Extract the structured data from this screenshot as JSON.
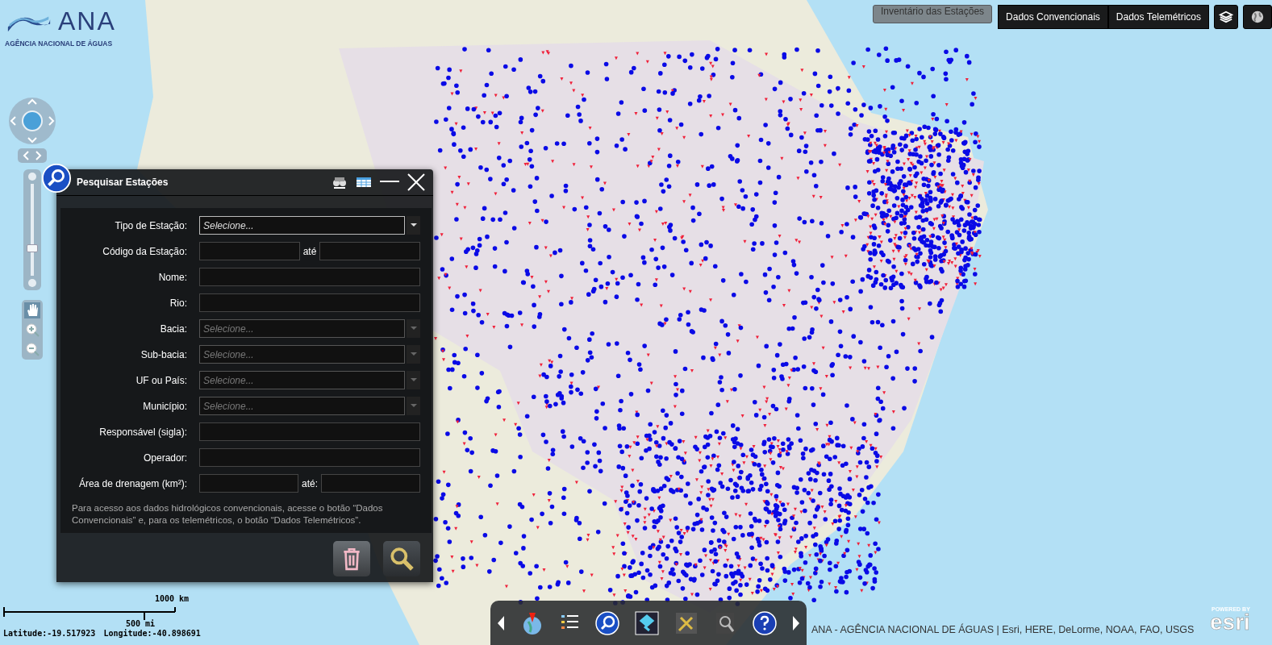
{
  "logo": {
    "name": "ANA",
    "subtitle": "AGÊNCIA NACIONAL DE ÁGUAS"
  },
  "top_buttons": [
    {
      "label": "Inventário das Estações",
      "selected": true
    },
    {
      "label": "Dados Convencionais",
      "selected": false
    },
    {
      "label": "Dados Telemétricos",
      "selected": false
    }
  ],
  "zoom_slider": {
    "level": 0.3
  },
  "search_panel": {
    "title": "Pesquisar Estações",
    "fields": [
      {
        "label": "Tipo de Estação:",
        "kind": "select",
        "placeholder": "Selecione...",
        "disabled": false
      },
      {
        "label": "Código da Estação:",
        "kind": "range",
        "separator": "até"
      },
      {
        "label": "Nome:",
        "kind": "text"
      },
      {
        "label": "Rio:",
        "kind": "text"
      },
      {
        "label": "Bacia:",
        "kind": "select",
        "placeholder": "Selecione...",
        "disabled": true
      },
      {
        "label": "Sub-bacia:",
        "kind": "select",
        "placeholder": "Selecione...",
        "disabled": true
      },
      {
        "label": "UF ou País:",
        "kind": "select",
        "placeholder": "Selecione...",
        "disabled": true
      },
      {
        "label": "Município:",
        "kind": "select",
        "placeholder": "Selecione...",
        "disabled": true
      },
      {
        "label": "Responsável (sigla):",
        "kind": "text"
      },
      {
        "label": "Operador:",
        "kind": "text"
      },
      {
        "label": "Área de drenagem (km²):",
        "kind": "range",
        "separator": "até:"
      }
    ],
    "note": "Para acesso aos dados hidrológicos convencionais, acesse o botão “Dados Convencionais” e, para os telemétricos, o botão “Dados Telemétricos”."
  },
  "scale_bar": {
    "metric": "1000 km",
    "imperial": "500 mi"
  },
  "coordinates": {
    "latitude": "Latitude:-19.517923",
    "longitude": "Longitude:-40.898691"
  },
  "attribution": "ANA - AGÊNCIA NACIONAL DE ÁGUAS | Esri, HERE, DeLorme, NOAA, FAO, USGS",
  "esri_badge": {
    "tagline": "POWERED BY",
    "wordmark": "esri"
  }
}
